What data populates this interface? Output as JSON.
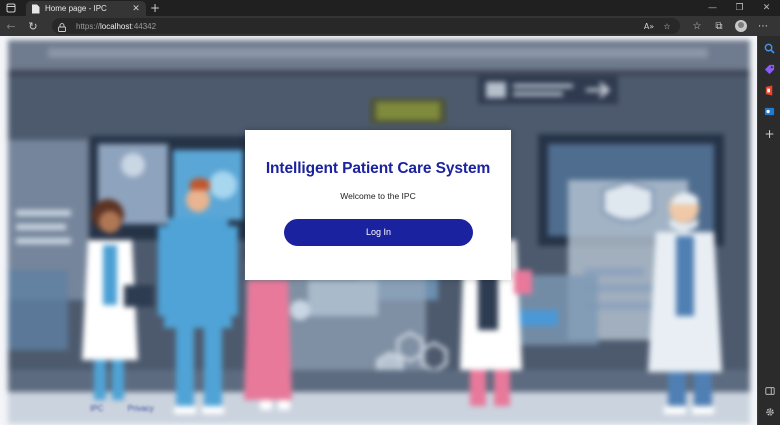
{
  "browser": {
    "tab_title": "Home page - IPC",
    "tab_close": "✕",
    "new_tab": "+",
    "url_scheme": "https://",
    "url_host": "localhost",
    "url_port": ":44342",
    "window_controls": {
      "minimize": "—",
      "maximize": "❐",
      "close": "✕"
    },
    "nav": {
      "back": "←",
      "refresh": "↻"
    },
    "address_icons": {
      "read_aloud": "A»",
      "favorites_add": "☆"
    },
    "toolbar_icons": {
      "favorites": "☆",
      "collections": "⧉",
      "more": "⋯"
    }
  },
  "sidebar": {
    "add": "+",
    "colors": {
      "search": "#4a90e2",
      "shopping": "#8a5cf5",
      "office": "#e8452c",
      "outlook": "#1f7ad1"
    }
  },
  "page": {
    "title": "Intelligent Patient Care System",
    "subtitle": "Welcome to the IPC",
    "login_label": "Log In",
    "footer_link_1": "IPC",
    "footer_link_2": "Privacy",
    "accent_color": "#1b229f"
  }
}
